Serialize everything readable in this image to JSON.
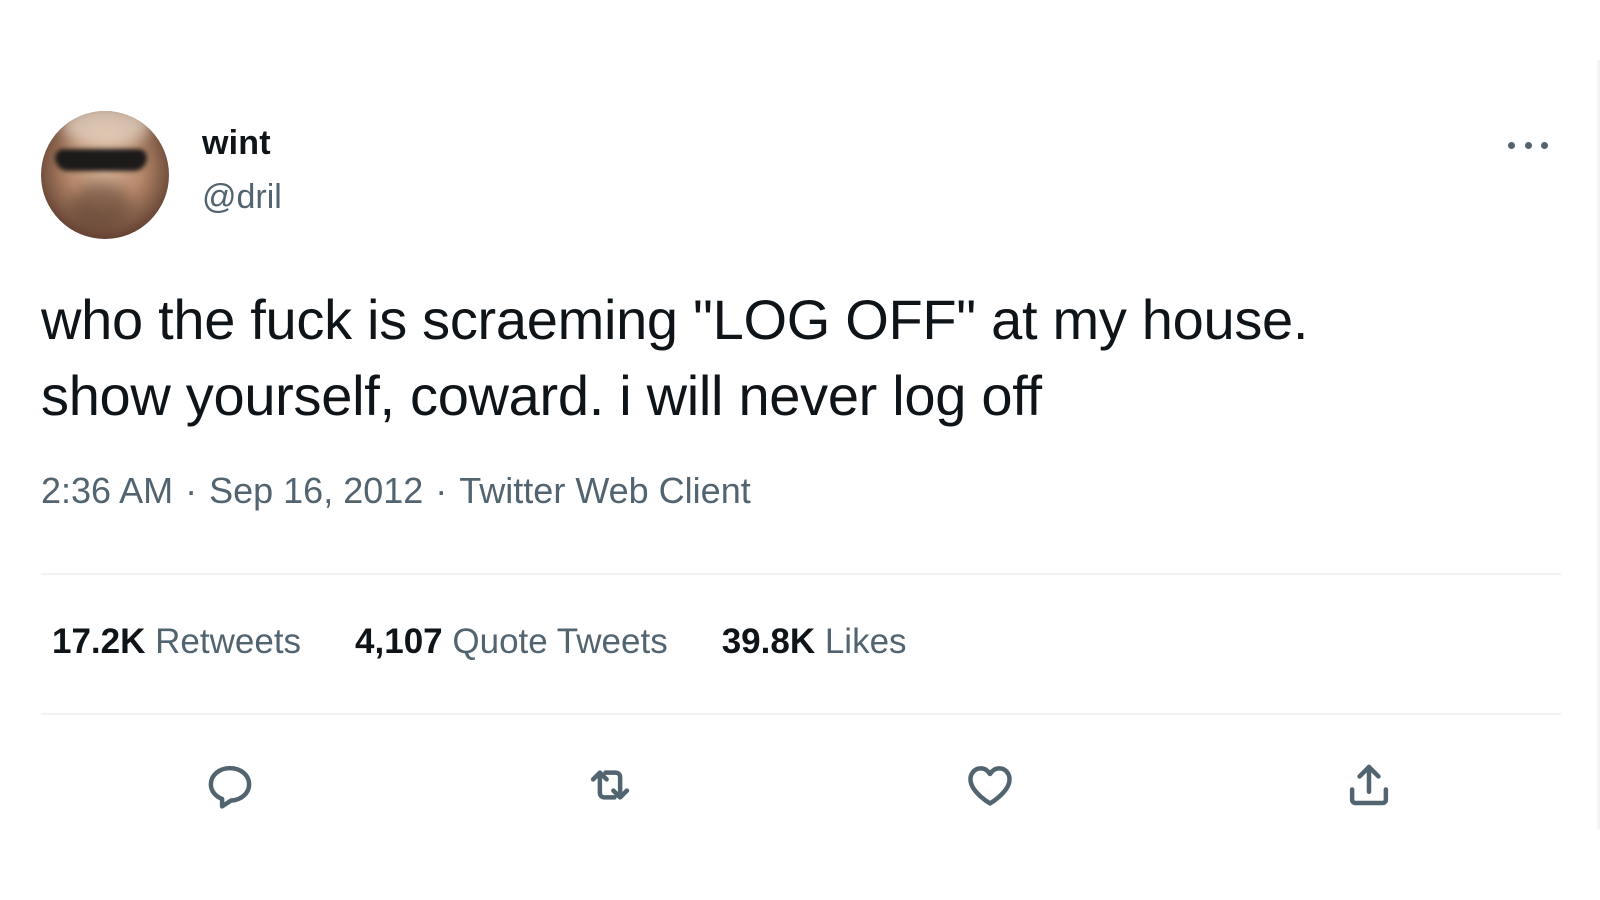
{
  "author": {
    "display_name": "wint",
    "handle": "@dril"
  },
  "tweet": {
    "text": "who the fuck is scraeming \"LOG OFF\" at my house.\nshow yourself, coward. i will never log off"
  },
  "meta": {
    "time": "2:36 AM",
    "separator": "·",
    "date": "Sep 16, 2012",
    "source": "Twitter Web Client"
  },
  "stats": {
    "retweets": {
      "count": "17.2K",
      "label": "Retweets"
    },
    "quote_tweets": {
      "count": "4,107",
      "label": "Quote Tweets"
    },
    "likes": {
      "count": "39.8K",
      "label": "Likes"
    }
  },
  "icons": {
    "more": "more-horizontal-icon",
    "reply": "reply-icon",
    "retweet": "retweet-icon",
    "like": "heart-icon",
    "share": "share-icon"
  },
  "colors": {
    "text_primary": "#0f1419",
    "text_secondary": "#536471",
    "divider": "#eff3f4",
    "background": "#ffffff"
  }
}
